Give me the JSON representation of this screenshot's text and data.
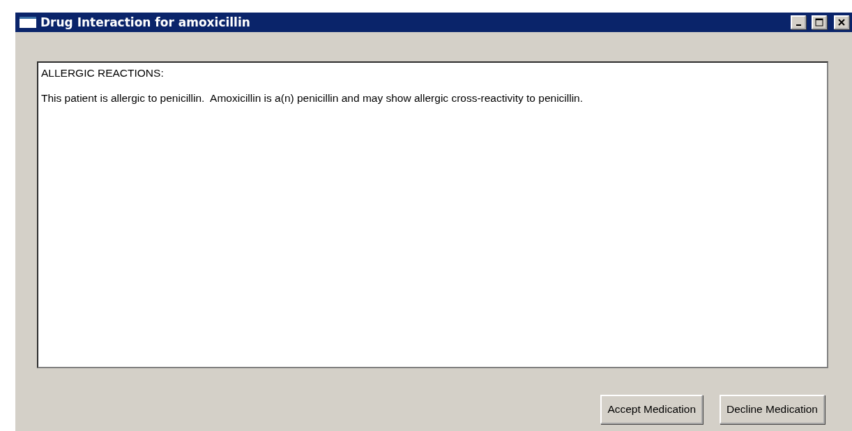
{
  "window": {
    "title": "Drug Interaction for amoxicillin"
  },
  "message": {
    "heading": "ALLERGIC REACTIONS:",
    "body": "This patient is allergic to penicillin.  Amoxicillin is a(n) penicillin and may show allergic cross-reactivity to penicillin."
  },
  "buttons": [
    "Accept Medication",
    "Decline Medication"
  ]
}
